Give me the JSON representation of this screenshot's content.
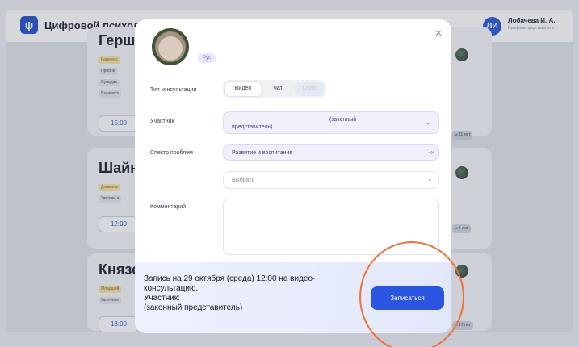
{
  "app": {
    "title": "Цифровой психолог",
    "user_initials": "ЛИ",
    "user_name": "Лобачева И. А.",
    "user_subtitle": "Профиль представителя"
  },
  "background_cards": [
    {
      "name": "Герш",
      "tag": "Раннее с",
      "lines": [
        "Пробле",
        "Суицида",
        "Взаимост"
      ],
      "time": "15:00",
      "age": "ы 11 лет"
    },
    {
      "name": "Шайн",
      "tag": "Дошколь",
      "lines": [
        "Эмоции и"
      ],
      "time": "12:00",
      "age": "ы 5 лет"
    },
    {
      "name": "Князе",
      "tag": "Младший",
      "lines": [
        "Увлечени"
      ],
      "time": "13:00",
      "age": "ы 17 лет"
    }
  ],
  "modal": {
    "language_badge": "Рус",
    "close_icon": "close-icon",
    "consult_type_label": "Тип консультации",
    "consult_types": [
      {
        "label": "Видео",
        "state": "active"
      },
      {
        "label": "Чат",
        "state": "normal"
      },
      {
        "label": "Очно",
        "state": "disabled"
      }
    ],
    "participant_label": "Участник",
    "participant_value_top": "(законный",
    "participant_value_bottom": "представитель)",
    "problems_label": "Спектр проблем",
    "problem_selected": "Развитие и воспитание",
    "problem_placeholder": "Выбрать",
    "comment_label": "Комментарий",
    "comment_value": "",
    "summary_line1": "Запись на 29 октября (среда) 12:00 на видео-",
    "summary_line2": "консультацию.",
    "summary_line3": "Участник:",
    "summary_line4": "(законный представитель)",
    "submit_label": "Записаться"
  },
  "colors": {
    "accent": "#2a55e0",
    "annotation": "#f07239",
    "select_fill": "#f2effc"
  }
}
